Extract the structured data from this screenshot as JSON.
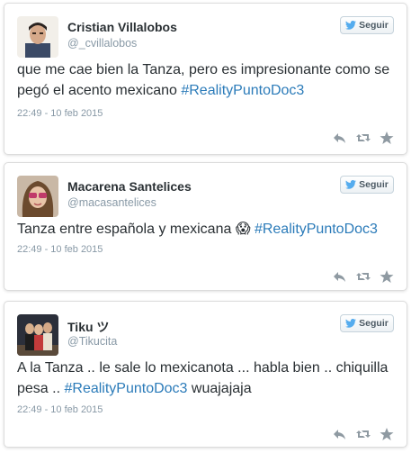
{
  "follow_label": "Seguir",
  "colors": {
    "link": "#2b7bb9",
    "muted": "#8899a6",
    "text": "#292f33",
    "twitter_blue": "#55acee",
    "action_gray": "#8f9aa2"
  },
  "tweets": [
    {
      "name": "Cristian Villalobos",
      "handle": "@_cvillalobos",
      "text_before": "que me cae bien la Tanza, pero es impresionante como se pegó el acento mexicano ",
      "hashtag": "#RealityPuntoDoc3",
      "text_after": "",
      "timestamp": "22:49 - 10 feb 2015"
    },
    {
      "name": "Macarena Santelices",
      "handle": "@macasantelices",
      "text_before": "Tanza entre española y mexicana ",
      "emoji": "😱",
      "hashtag": "#RealityPuntoDoc3",
      "text_after": "",
      "timestamp": "22:49 - 10 feb 2015"
    },
    {
      "name": "Tiku ツ",
      "handle": "@Tikucita",
      "text_before": "A la Tanza .. le sale lo mexicanota ...  habla bien .. chiquilla pesa .. ",
      "hashtag": "#RealityPuntoDoc3",
      "text_after": " wuajajaja",
      "timestamp": "22:49 - 10 feb 2015"
    }
  ],
  "icons": [
    "twitter-bird-icon",
    "reply-icon",
    "retweet-icon",
    "favorite-star-icon"
  ]
}
